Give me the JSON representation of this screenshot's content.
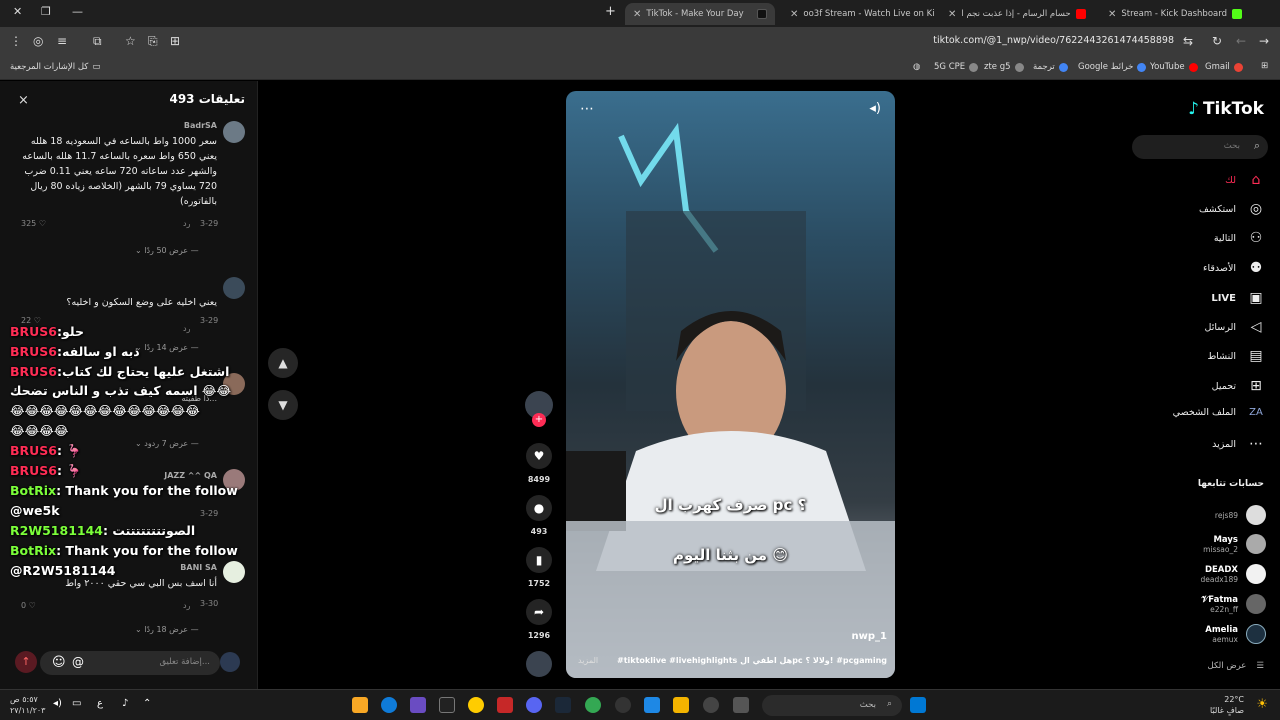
{
  "tabs": [
    {
      "title": "TikTok - Make Your Day"
    },
    {
      "title": "oo3f Stream - Watch Live on Ki"
    },
    {
      "title": "حسام الرسام - إذا عذبت نجم ا"
    },
    {
      "title": "Stream - Kick Dashboard"
    }
  ],
  "address": {
    "url": "tiktok.com/@1_nwp/video/7622443261474458898"
  },
  "bookmarks": {
    "all": "كل الإشارات المرجعية",
    "items": [
      "Gmail",
      "YouTube",
      "Google خرائط",
      "ترجمة",
      "zte g5",
      "5G CPE"
    ]
  },
  "comments": {
    "title": "تعليقات 493",
    "close": "×",
    "items": [
      {
        "user": "BadrSA",
        "text": "سعر 1000 واط بالساعه في السعوديه 18 هلله يعني 650 واط سعره بالساعه 11.7 هلله بالساعه والشهر عدد ساعاته 720 ساعه يعني 0.11 ضرب 720 يساوي 79 بالشهر (الخلاصه زياده 80 ريال بالفاتوره)",
        "date": "3-29",
        "reply": "رد",
        "likes": "325",
        "replies": "عرض 50 ردًا"
      },
      {
        "user": "",
        "text": "يعني اخليه على وضع السكون و اخليه؟",
        "date": "3-29",
        "reply": "رد",
        "likes": "22",
        "replies": "عرض 14 ردًا"
      },
      {
        "user": "سفيان",
        "text": "...ذا طفيته",
        "date": "",
        "reply": "",
        "likes": "",
        "replies": "عرض 7 ردود"
      },
      {
        "user": "JAZZ ^^ QA",
        "text": "",
        "date": "3-29",
        "reply": "رد",
        "likes": "",
        "replies": ""
      },
      {
        "user": "BANI SA",
        "text": "أنا اسف بس البي سي حقي ٢٠٠٠ واط",
        "date": "3-30",
        "reply": "رد",
        "likes": "0",
        "replies": "عرض 18 ردًا"
      }
    ],
    "input_placeholder": "إضافة تعليق..."
  },
  "overlay_chat": [
    {
      "name": "BRUS6",
      "msg": ":حلو",
      "kind": "n"
    },
    {
      "name": "BRUS6",
      "msg": ":ذبه او سالفه",
      "kind": "n"
    },
    {
      "name": "BRUS6",
      "msg": ":اشتغل عليها يحتاج لك كتاب",
      "kind": "n"
    },
    {
      "name": "",
      "msg": "اسمه كيف تذب و الناس تضحك 😂😂",
      "kind": "w"
    },
    {
      "name": "",
      "msg": "😂😂😂😂😂😂😂😂😂😂😂😂😂",
      "kind": "w"
    },
    {
      "name": "",
      "msg": "😂😂😂😂",
      "kind": "w"
    },
    {
      "name": "BRUS6",
      "msg": ": 🦩",
      "kind": "n"
    },
    {
      "name": "BRUS6",
      "msg": ": 🦩",
      "kind": "n"
    },
    {
      "name": "BotRix",
      "msg": ": Thank you for the follow",
      "kind": "g"
    },
    {
      "name": "",
      "msg": "@we5k",
      "kind": "w"
    },
    {
      "name": "R2W5181144",
      "msg": ": الصوتتتتتتتتت",
      "kind": "g"
    },
    {
      "name": "BotRix",
      "msg": ": Thank you for the follow",
      "kind": "g"
    },
    {
      "name": "",
      "msg": "@R2W5181144",
      "kind": "w"
    }
  ],
  "video": {
    "caption1": "صرف كهرب ال pc ؟",
    "caption2": "من بثنا اليوم 😊",
    "user": "nwp_1",
    "desc": "#tiktoklive #livehighlights هل اطفي الpc ولالا ؟! #pcgaming ...",
    "more": "المزيد"
  },
  "actions": {
    "likes": "8499",
    "comments": "493",
    "saves": "1752",
    "shares": "1296"
  },
  "sidebar": {
    "logo": "TikTok",
    "search_placeholder": "بحث",
    "nav": [
      "لك",
      "استكشف",
      "التالية",
      "الأصدقاء",
      "LIVE",
      "الرسائل",
      "النشاط",
      "تحميل",
      "الملف الشخصي",
      "المزيد"
    ],
    "following_title": "حسابات تتابعها",
    "following": [
      {
        "name": "",
        "handle": "rejs89"
      },
      {
        "name": "Mays",
        "handle": "missao_2"
      },
      {
        "name": "DEADX",
        "handle": "deadx189"
      },
      {
        "name": "𝒱Fatma",
        "handle": "e22n_ff"
      },
      {
        "name": "Amelia",
        "handle": "aemux"
      }
    ],
    "see_all": "عرض الكل"
  },
  "taskbar": {
    "search": "بحث",
    "temp": "22°C",
    "weather": "صافٍ غالبًا",
    "time": "٥:٥٧ ص",
    "date": "٢٧/١١/٢٠٣"
  },
  "colors": {
    "accent": "#fe2c55",
    "bg": "#000000",
    "panel": "#121212"
  }
}
